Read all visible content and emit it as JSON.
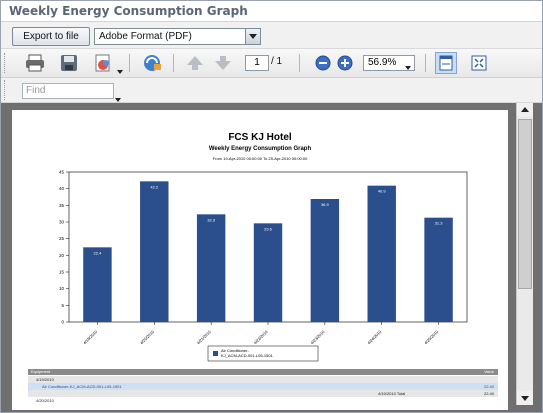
{
  "window": {
    "title": "Weekly Energy Consumption Graph"
  },
  "exportbar": {
    "export_label": "Export to file",
    "format_value": "Adobe Format (PDF)"
  },
  "toolbar": {
    "page_current": "1",
    "page_total": "/ 1",
    "zoom_value": "56.9%"
  },
  "find": {
    "placeholder": "Find"
  },
  "report": {
    "title": "FCS KJ Hotel",
    "subtitle": "Weekly Energy Consumption Graph",
    "range": "From 19-Apr-2010 00:00:00 To 25-Apr-2010 00:00:00",
    "table": {
      "header_left": "Equipment",
      "header_right": "Value",
      "rows": [
        {
          "label": "4/19/2010",
          "value": "",
          "total": ""
        },
        {
          "label": "Air Conditioner-KJ_ACM-ACD-001-L05-1501",
          "value": "22.40",
          "total": ""
        },
        {
          "label": "",
          "value": "22.40",
          "total": "4/19/2010 Total"
        },
        {
          "label": "4/20/2010",
          "value": "",
          "total": ""
        }
      ]
    }
  },
  "chart_data": {
    "type": "bar",
    "categories": [
      "4/19/2010",
      "4/20/2010",
      "4/21/2010",
      "4/22/2010",
      "4/23/2010",
      "4/24/2010",
      "4/25/2010"
    ],
    "series": [
      {
        "name": "Air Conditioner-KJ_ACM-ACD-001-L05-1501",
        "values": [
          22.4,
          42.2,
          32.3,
          29.6,
          36.9,
          40.9,
          31.3
        ]
      }
    ],
    "ylim": [
      0,
      45
    ],
    "yticks": [
      0,
      5,
      10,
      15,
      20,
      25,
      30,
      35,
      40,
      45
    ],
    "bar_color": "#2b4e8c",
    "grid": false,
    "legend": "bottom"
  }
}
